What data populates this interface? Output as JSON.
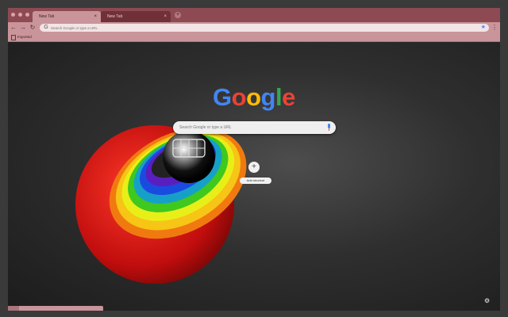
{
  "tabs": [
    {
      "label": "New Tab",
      "active": true
    },
    {
      "label": "New Tab",
      "active": false
    }
  ],
  "toolbar": {
    "back": "←",
    "forward": "→",
    "reload": "↻",
    "omnibox_placeholder": "Search Google or type a URL",
    "star": "★",
    "menu": "⋮"
  },
  "bookmarks": [
    {
      "label": "Imported"
    }
  ],
  "content": {
    "logo": [
      "G",
      "o",
      "o",
      "g",
      "l",
      "e"
    ],
    "logo_colors": [
      "#4285f4",
      "#ea4335",
      "#fbbc05",
      "#4285f4",
      "#34a853",
      "#ea4335"
    ],
    "search_placeholder": "Search Google or type a URL",
    "add_shortcut_label": "Add shortcut",
    "plus": "+",
    "gear": "⚙"
  },
  "status": {
    "progress": 0.12
  },
  "colors": {
    "frame": "#8e4a52",
    "toolbar": "#c9959a",
    "accent": "#4a8ef0"
  }
}
